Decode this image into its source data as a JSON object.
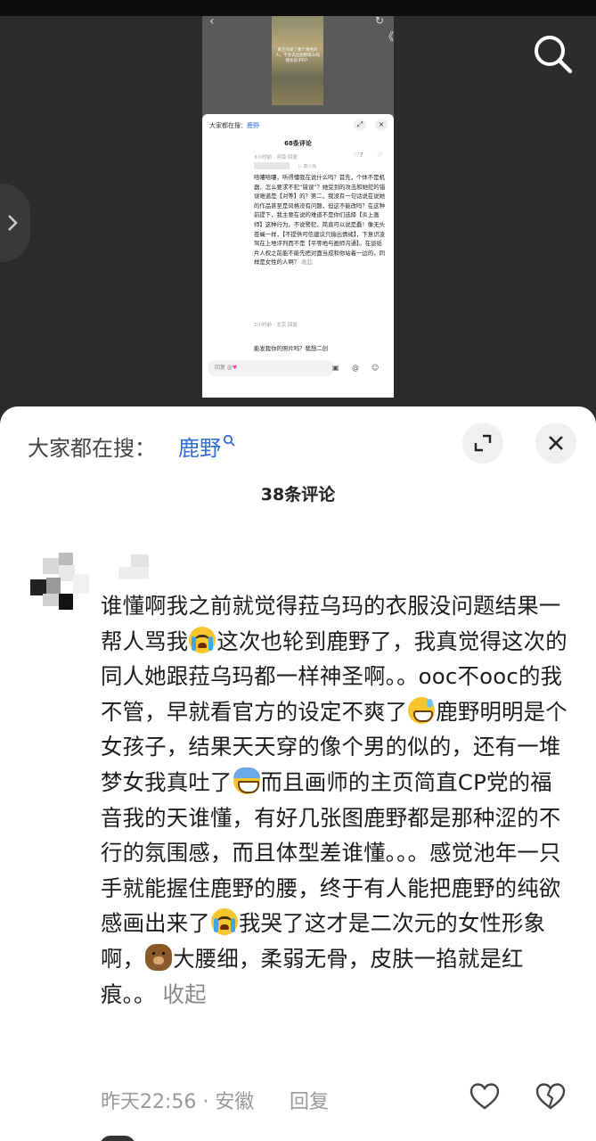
{
  "thumbnail": {
    "image_caption": "真正热爱了那个角色的人，不会说出鹿野那么纯情女孩子吗？",
    "search_prefix": "大家都在搜：",
    "search_term": "鹿野",
    "comment_count": "68条评论",
    "meta_top": "3小时前 · 河南     回复",
    "heart_count": "7",
    "reply_name": "▷ 廉小兔",
    "body": "哈嘍哈嘍，听得懂我在说什么吗？首先，个体不是机器，怎么要求不犯“错误”？她受到的攻击和她犯的错误难道是【对等】的？第二，我没有一句话说在说她的作品甚至是风格没有问题，但这不能改吗？在这种前提下，我主要在说的难道不是你们选择【炎上画师】这种行为，不说警犯，简直可以说是蠢！像无头苍蝇一样，【不提供可信建议只输出情绪】，下意识凌驾在上地评判而不是【平等地与画师沟通】。在谈纸片人权之前能不能先把对面当成和你站着一边的，同样是女性的人啊？",
    "collapse": "收起",
    "meta_bottom": "2小时前 · 北京     回复",
    "reply_snippet": "能发我你的照片吗？我想二创",
    "input_placeholder": "回复 @"
  },
  "sheet": {
    "search_prefix": "大家都在搜：",
    "search_term": "鹿野",
    "comment_count": "38条评论",
    "comment": {
      "segments": [
        "谁懂啊我之前就觉得菈乌玛的衣服没问题结果一帮人骂我",
        "这次也轮到鹿野了，我真觉得这次的同人她跟菈乌玛都一样神圣啊。。ooc不ooc的我不管，早就看官方的设定不爽了",
        "鹿野明明是个女孩子，结果天天穿的像个男的似的，还有一堆梦女我真吐了",
        "而且画师的主页简直CP党的福音我的天谁懂，有好几张图鹿野都是那种涩的不行的氛围感，而且体型差谁懂。。。感觉池年一只手就能握住鹿野的腰，终于有人能把鹿野的纯欲感画出来了",
        "我哭了这才是二次元的女性形象啊，",
        "大腰细，柔弱无骨，皮肤一掐就是红痕。。"
      ],
      "collapse": "收起",
      "emojis": [
        "loudly-crying-face-icon",
        "grinning-sweat-face-icon",
        "screaming-face-icon",
        "loudly-crying-face-icon",
        "bear-face-icon"
      ],
      "time_location": "昨天22:56 · 安徽",
      "reply_label": "回复"
    }
  },
  "colors": {
    "accent": "#2f6fd6",
    "viewer_bg": "#2c2c2c",
    "sheet_bg": "#ffffff",
    "meta_text": "#999999"
  }
}
